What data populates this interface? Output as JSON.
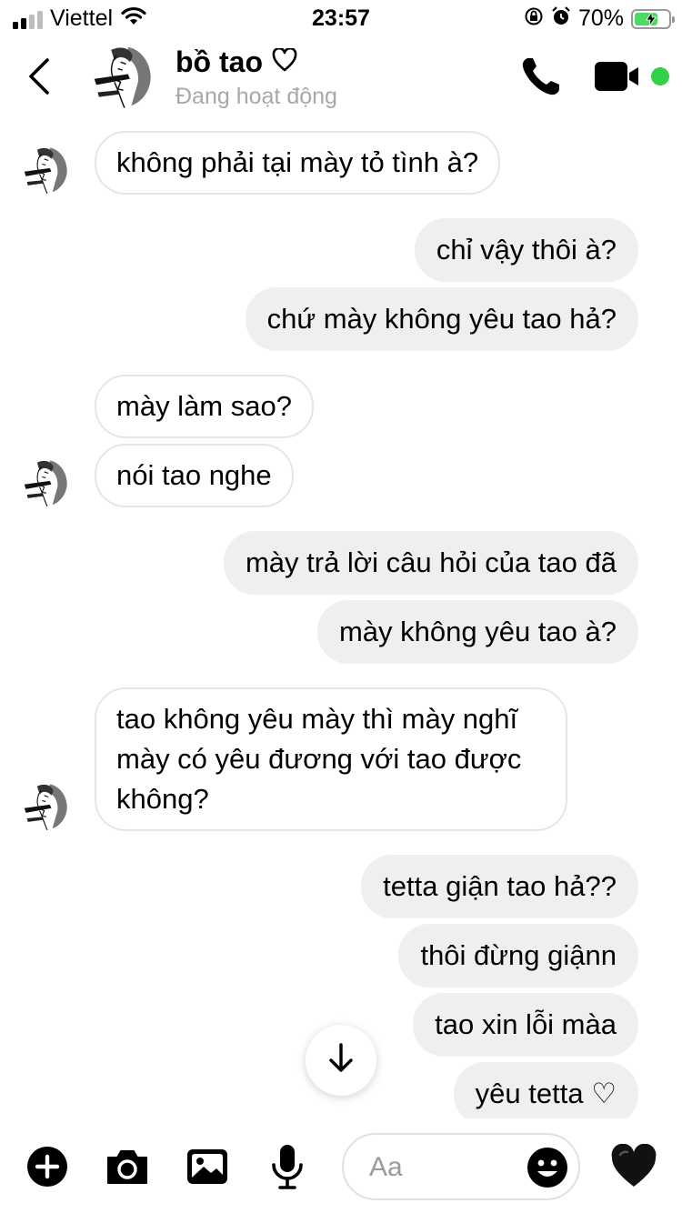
{
  "status_bar": {
    "carrier": "Viettel",
    "time": "23:57",
    "battery_percent": "70%",
    "battery_level": 0.7,
    "icons": [
      "signal-icon",
      "wifi-icon",
      "orientation-lock-icon",
      "alarm-icon",
      "battery-charging-icon"
    ]
  },
  "header": {
    "name": "bồ tao",
    "name_icon": "heart-outline-icon",
    "status": "Đang hoạt động",
    "buttons": [
      "back-icon",
      "phone-icon",
      "video-camera-icon"
    ],
    "online_color": "#31d14a"
  },
  "messages": [
    {
      "from": "them",
      "text": "không phải tại mày tỏ tình à?"
    },
    {
      "from": "me",
      "text": "chỉ vậy thôi à?"
    },
    {
      "from": "me",
      "text": "chứ mày không yêu tao hả?"
    },
    {
      "from": "them",
      "text": "mày làm sao?"
    },
    {
      "from": "them",
      "text": "nói tao nghe"
    },
    {
      "from": "me",
      "text": "mày trả lời câu hỏi của tao đã"
    },
    {
      "from": "me",
      "text": "mày không yêu tao à?"
    },
    {
      "from": "them",
      "text": "tao không yêu mày thì mày nghĩ mày có yêu đương với tao được không?"
    },
    {
      "from": "me",
      "text": "tetta giận tao hả??"
    },
    {
      "from": "me",
      "text": "thôi đừng giậnn"
    },
    {
      "from": "me",
      "text": "tao xin lỗi màa"
    },
    {
      "from": "me",
      "text": "yêu tetta ♡"
    }
  ],
  "composer": {
    "placeholder": "Aa",
    "tools": [
      "plus-icon",
      "camera-icon",
      "gallery-icon",
      "microphone-icon"
    ],
    "emoji_icon": "smiley-icon",
    "like_icon": "black-heart-icon"
  },
  "colors": {
    "incoming_bubble_border": "#e6e6e6",
    "outgoing_bubble_bg": "#efefef",
    "secondary_text": "#a8a8a8"
  }
}
